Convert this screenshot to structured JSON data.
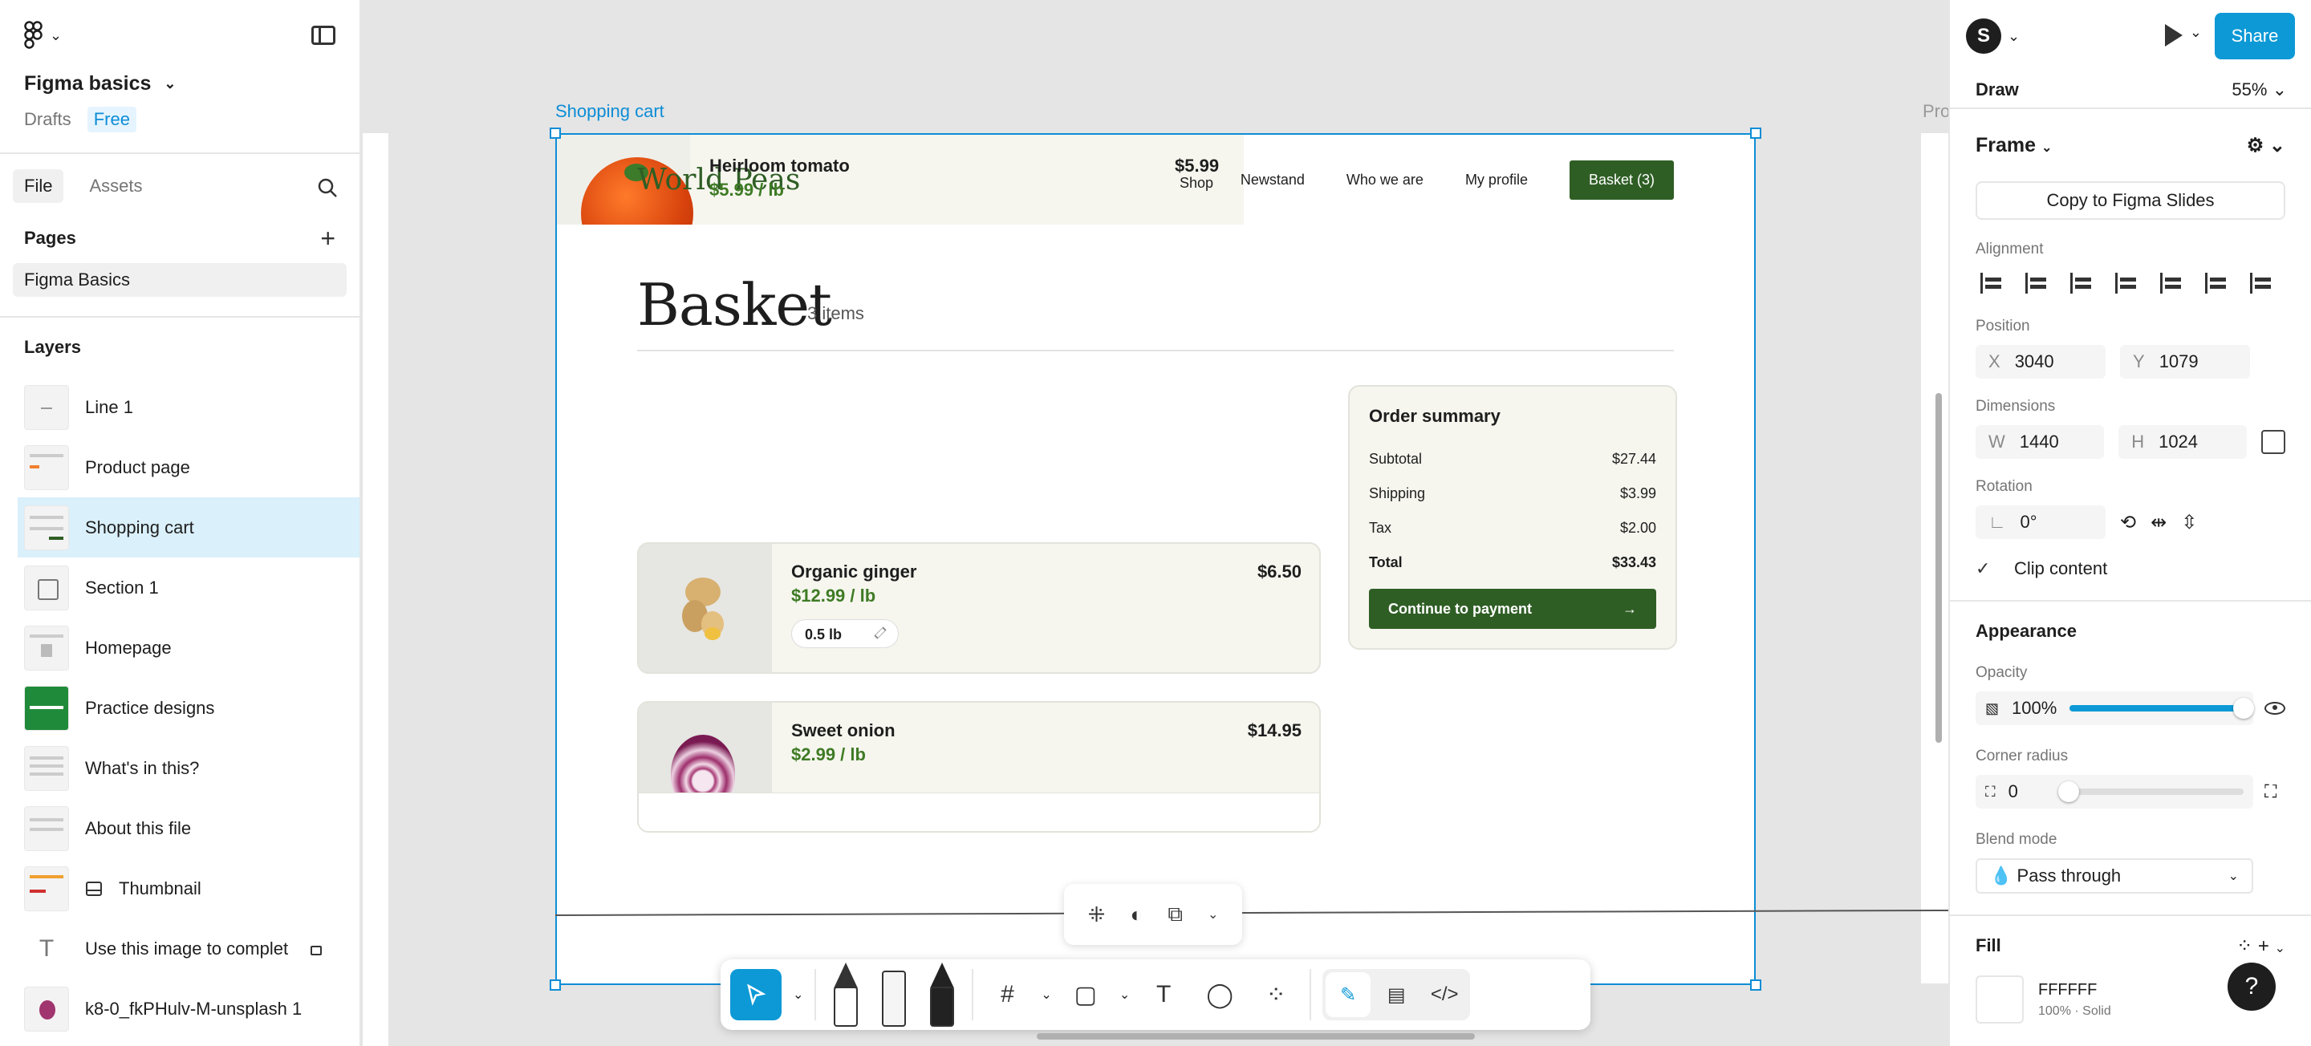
{
  "app": {
    "file_name": "Figma basics",
    "location": "Drafts",
    "plan_badge": "Free"
  },
  "left_tabs": [
    {
      "label": "File"
    },
    {
      "label": "Assets"
    }
  ],
  "pages": {
    "title": "Pages",
    "items": [
      {
        "label": "Figma Basics"
      }
    ]
  },
  "layers": {
    "title": "Layers",
    "items": [
      {
        "label": "Line 1"
      },
      {
        "label": "Product page"
      },
      {
        "label": "Shopping cart"
      },
      {
        "label": "Section 1"
      },
      {
        "label": "Homepage"
      },
      {
        "label": "Practice designs"
      },
      {
        "label": "What's in this?"
      },
      {
        "label": "About this file"
      },
      {
        "label": "Thumbnail"
      },
      {
        "label": "Use this image to complet"
      },
      {
        "label": "k8-0_fkPHulv-M-unsplash 1"
      }
    ]
  },
  "canvas": {
    "frame_label": "Shopping cart",
    "frame_label_right": "Pro",
    "nav": [
      "Newstand",
      "Who we are",
      "My profile"
    ],
    "basket_button": "Basket (3)",
    "overlay": {
      "title": "Heirloom tomato",
      "rate": "$5.99 / lb",
      "brand": "World Peas",
      "price": "$5.99",
      "shop": "Shop"
    },
    "basket_title": "Basket",
    "items_count": "3 items",
    "cart_items": [
      {
        "name": "Organic ginger",
        "rate": "$12.99 / lb",
        "price": "$6.50",
        "qty": "0.5 lb"
      },
      {
        "name": "Sweet onion",
        "rate": "$2.99 / lb",
        "price": "$14.95"
      }
    ],
    "summary": {
      "title": "Order summary",
      "rows": [
        {
          "label": "Subtotal",
          "value": "$27.44"
        },
        {
          "label": "Shipping",
          "value": "$3.99"
        },
        {
          "label": "Tax",
          "value": "$2.00"
        },
        {
          "label": "Total",
          "value": "$33.43"
        }
      ],
      "button": "Continue to payment"
    }
  },
  "right_panel": {
    "avatar_letter": "S",
    "share_label": "Share",
    "mode": "Draw",
    "zoom": "55%",
    "frame_type": "Frame",
    "copy_button": "Copy to Figma Slides",
    "alignment_label": "Alignment",
    "position_label": "Position",
    "x_prefix": "X",
    "x_value": "3040",
    "y_prefix": "Y",
    "y_value": "1079",
    "dimensions_label": "Dimensions",
    "w_prefix": "W",
    "w_value": "1440",
    "h_prefix": "H",
    "h_value": "1024",
    "rotation_label": "Rotation",
    "rotation_value": "0°",
    "clip_content": "Clip content",
    "appearance_title": "Appearance",
    "opacity_label": "Opacity",
    "opacity_value": "100%",
    "opacity_fraction": 1.0,
    "corner_radius_label": "Corner radius",
    "corner_radius_value": "0",
    "blend_label": "Blend mode",
    "blend_value": "Pass through",
    "fill_title": "Fill",
    "fill_hex": "FFFFFF",
    "fill_sub": "100% · Solid"
  },
  "colors": {
    "accent": "#0d99d6",
    "selection": "#daf0fb",
    "brand_green": "#2f5e25",
    "price_green": "#3f7b25"
  }
}
